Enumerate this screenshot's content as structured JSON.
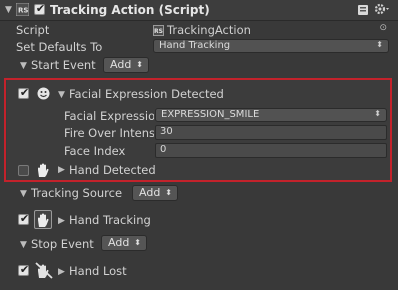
{
  "component": {
    "title": "Tracking Action (Script)",
    "enabled": true,
    "header_icons": [
      "script-badge-icon",
      "book-icon",
      "gear-icon"
    ]
  },
  "fields": {
    "script_label": "Script",
    "script_value": "TrackingAction",
    "defaults_label": "Set Defaults To",
    "defaults_value": "Hand Tracking"
  },
  "start_event": {
    "label": "Start Event",
    "add_label": "Add",
    "items": [
      {
        "label": "Facial Expression Detected",
        "enabled": true,
        "icon": "smiley-icon",
        "expanded": true,
        "properties": [
          {
            "label": "Facial Expressio",
            "value": "EXPRESSION_SMILE",
            "type": "dropdown"
          },
          {
            "label": "Fire Over Intens",
            "value": "30",
            "type": "number"
          },
          {
            "label": "Face Index",
            "value": "0",
            "type": "number"
          }
        ]
      },
      {
        "label": "Hand Detected",
        "enabled": false,
        "icon": "hand-icon",
        "expanded": false
      }
    ]
  },
  "tracking_source": {
    "label": "Tracking Source",
    "add_label": "Add",
    "items": [
      {
        "label": "Hand Tracking",
        "enabled": true,
        "icon": "hand-icon"
      }
    ]
  },
  "stop_event": {
    "label": "Stop Event",
    "add_label": "Add",
    "items": [
      {
        "label": "Hand Lost",
        "enabled": true,
        "icon": "hand-lost-icon"
      }
    ]
  },
  "colors": {
    "highlight_border": "#c3222b",
    "panel_bg": "#393939"
  }
}
